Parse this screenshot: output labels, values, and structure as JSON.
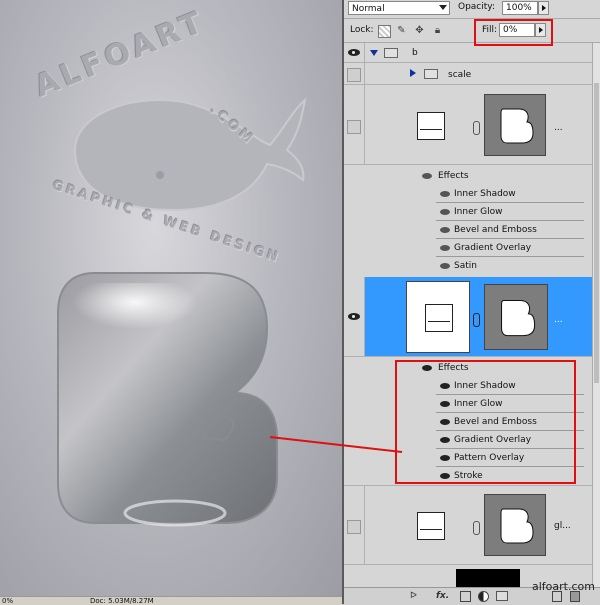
{
  "canvas": {
    "watermark_title": "ALFOART",
    "watermark_com": ".COM",
    "watermark_sub": "GRAPHIC & WEB DESIGN"
  },
  "status": {
    "zoom": "0%",
    "doc": "Doc: 5.03M/8.27M"
  },
  "toolbar": {
    "blend_mode": "Normal",
    "opacity_label": "Opacity:",
    "opacity_value": "100%",
    "lock_label": "Lock:",
    "fill_label": "Fill:",
    "fill_value": "0%"
  },
  "layers": {
    "group_b": "b",
    "group_scale": "scale",
    "layer3_name": "gl...",
    "effects_label": "Effects",
    "layer1_effects": [
      "Inner Shadow",
      "Inner Glow",
      "Bevel and Emboss",
      "Gradient Overlay",
      "Satin"
    ],
    "layer2_effects": [
      "Inner Shadow",
      "Inner Glow",
      "Bevel and Emboss",
      "Gradient Overlay",
      "Pattern Overlay",
      "Stroke"
    ],
    "ellipsis": "..."
  },
  "bottom": {
    "link": "ᐅ",
    "fx": "fx.",
    "credit": "alfoart.com"
  },
  "colors": {
    "selection": "#3399ff",
    "highlight": "#e01010"
  }
}
